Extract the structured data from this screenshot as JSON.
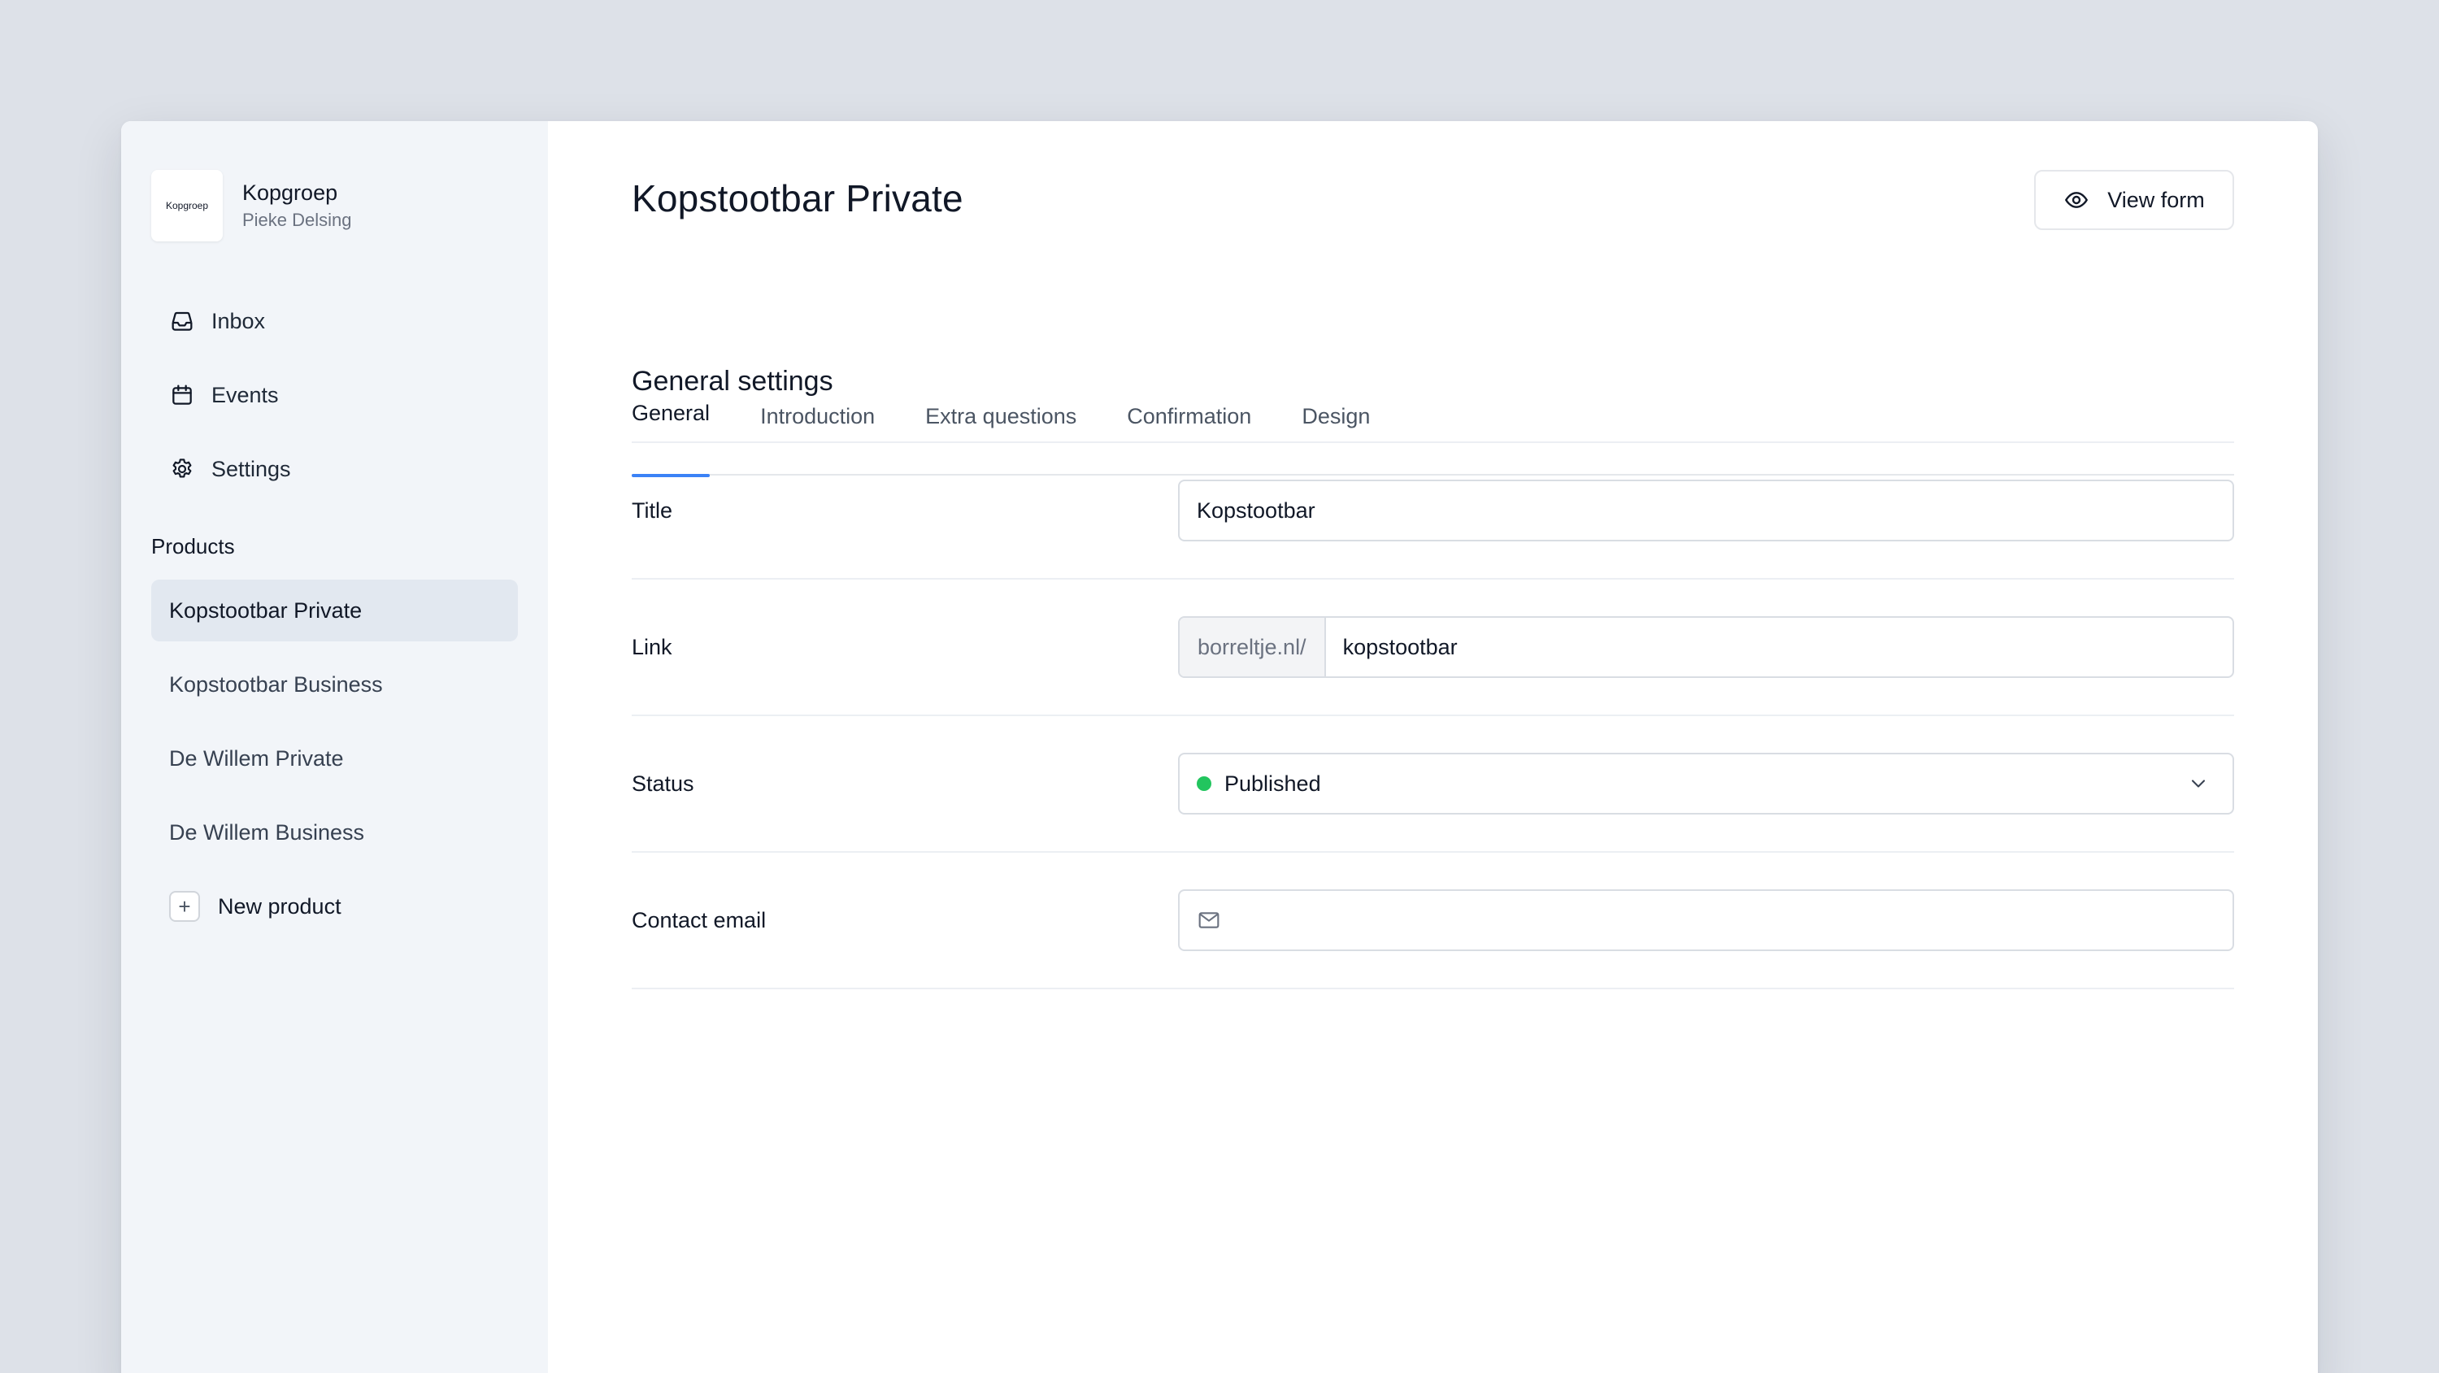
{
  "colors": {
    "accent": "#3b82f6",
    "status_published": "#22c55e",
    "sidebar_bg": "#f2f5f9",
    "page_bg": "#dde1e8"
  },
  "org": {
    "logo_text": "Kopgroep",
    "name": "Kopgroep",
    "user": "Pieke Delsing"
  },
  "nav": [
    {
      "label": "Inbox",
      "icon": "inbox-icon"
    },
    {
      "label": "Events",
      "icon": "calendar-icon"
    },
    {
      "label": "Settings",
      "icon": "gear-icon"
    }
  ],
  "products": {
    "title": "Products",
    "items": [
      {
        "label": "Kopstootbar Private",
        "active": true
      },
      {
        "label": "Kopstootbar Business",
        "active": false
      },
      {
        "label": "De Willem Private",
        "active": false
      },
      {
        "label": "De Willem Business",
        "active": false
      }
    ],
    "new_label": "New product"
  },
  "header": {
    "title": "Kopstootbar Private",
    "view_form_label": "View form"
  },
  "tabs": [
    {
      "label": "General",
      "active": true
    },
    {
      "label": "Introduction",
      "active": false
    },
    {
      "label": "Extra questions",
      "active": false
    },
    {
      "label": "Confirmation",
      "active": false
    },
    {
      "label": "Design",
      "active": false
    }
  ],
  "general": {
    "heading": "General settings",
    "title_label": "Title",
    "title_value": "Kopstootbar",
    "link_label": "Link",
    "link_prefix": "borreltje.nl/",
    "link_value": "kopstootbar",
    "status_label": "Status",
    "status_value": "Published",
    "contact_label": "Contact email",
    "contact_value": ""
  }
}
